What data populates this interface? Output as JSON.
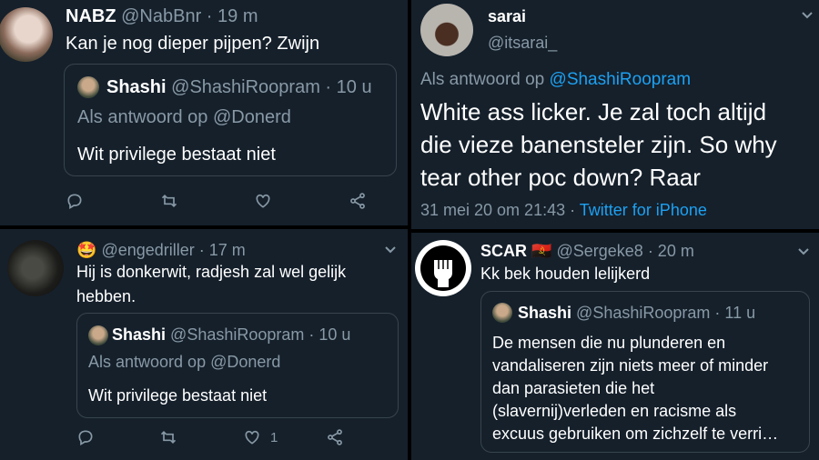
{
  "tweet1": {
    "name": "NABZ",
    "handle": "@NabBnr",
    "time": "· 19 m",
    "text": "Kan je nog dieper pijpen? Zwijn",
    "quote": {
      "name": "Shashi",
      "handle": "@ShashiRoopram",
      "time": "· 10 u",
      "reply_to": "Als antwoord op @Donerd",
      "text": "Wit privilege bestaat niet"
    }
  },
  "tweet2": {
    "emoji": "🤩",
    "handle": "@engedriller",
    "time": "· 17 m",
    "text_line1": "Hij is donkerwit, radjesh zal wel gelijk",
    "text_line2": "hebben.",
    "quote": {
      "name": "Shashi",
      "handle": "@ShashiRoopram",
      "time": "· 10 u",
      "reply_to": "Als antwoord op @Donerd",
      "text": "Wit privilege bestaat niet"
    },
    "like_count": "1"
  },
  "tweet3": {
    "name": "sarai",
    "handle": "@itsarai_",
    "reply_label": "Als antwoord op",
    "reply_handle": "@ShashiRoopram",
    "text_line1": "White ass licker. Je zal toch altijd",
    "text_line2": "die vieze banensteler zijn. So why",
    "text_line3": "tear other poc down? Raar",
    "date": "31 mei 20 om 21:43 ·",
    "client": "Twitter for iPhone"
  },
  "tweet4": {
    "name": "SCAR",
    "flag": "🇦🇴",
    "handle": "@Sergeke8",
    "time": "· 20 m",
    "text": "Kk bek houden lelijkerd",
    "quote": {
      "name": "Shashi",
      "handle": "@ShashiRoopram",
      "time": "· 11 u",
      "line1": "De mensen die nu plunderen en",
      "line2": "vandaliseren zijn niets meer of minder",
      "line3": "dan parasieten die het",
      "line4": "(slavernij)verleden en racisme als",
      "line5": "excuus gebruiken om zichzelf te verri…"
    }
  },
  "icons": [
    "reply-icon",
    "retweet-icon",
    "like-icon",
    "share-icon",
    "chevron-down-icon",
    "raised-fist-icon"
  ],
  "colors": {
    "background": "#15202b",
    "muted": "#8899a6",
    "link": "#1da1f2",
    "border": "#38444d"
  }
}
